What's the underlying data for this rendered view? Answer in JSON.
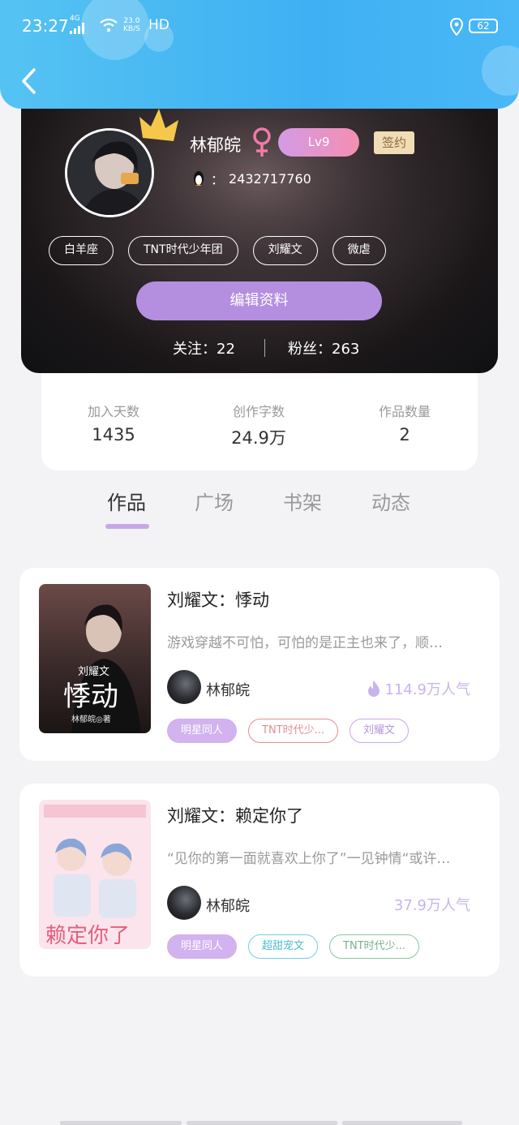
{
  "status_bar": {
    "time": "23:27",
    "network": "4G",
    "speed_value": "23.0",
    "speed_unit": "KB/S",
    "hd": "HD",
    "battery": "62"
  },
  "header": {
    "back_icon": "chevron-left-icon"
  },
  "profile": {
    "name": "林郁皖",
    "gender_icon": "female-icon",
    "level": "Lv9",
    "sign_badge": "签约",
    "qq_prefix": "：",
    "qq_number": "2432717760",
    "tags": [
      "白羊座",
      "TNT时代少年团",
      "刘耀文",
      "微虐"
    ],
    "edit_button": "编辑资料",
    "following_label": "关注：22",
    "followers_label": "粉丝：263"
  },
  "stats": [
    {
      "label": "加入天数",
      "value": "1435"
    },
    {
      "label": "创作字数",
      "value": "24.9万"
    },
    {
      "label": "作品数量",
      "value": "2"
    }
  ],
  "tabs": [
    {
      "label": "作品",
      "active": true
    },
    {
      "label": "广场",
      "active": false
    },
    {
      "label": "书架",
      "active": false
    },
    {
      "label": "动态",
      "active": false
    }
  ],
  "works": [
    {
      "title": "刘耀文：悸动",
      "description": "游戏穿越不可怕，可怕的是正主也来了，顺…",
      "author": "林郁皖",
      "popularity": "114.9万人气",
      "hot_icon": "flame-icon",
      "cover_text_top": "刘耀文",
      "cover_text_main": "悸动",
      "cover_text_sub": "林郁皖◎著",
      "tags": [
        "明星同人",
        "TNT时代少...",
        "刘耀文"
      ]
    },
    {
      "title": "刘耀文：赖定你了",
      "description": "“见你的第一面就喜欢上你了”一见钟情“或许…",
      "author": "林郁皖",
      "popularity": "37.9万人气",
      "cover_text_main": "赖定你了",
      "tags": [
        "明星同人",
        "超甜宠文",
        "TNT时代少..."
      ]
    }
  ],
  "colors": {
    "header_blue": "#3fb0f3",
    "accent_purple": "#b48fe0",
    "popularity_purple": "#c8b4ec"
  }
}
